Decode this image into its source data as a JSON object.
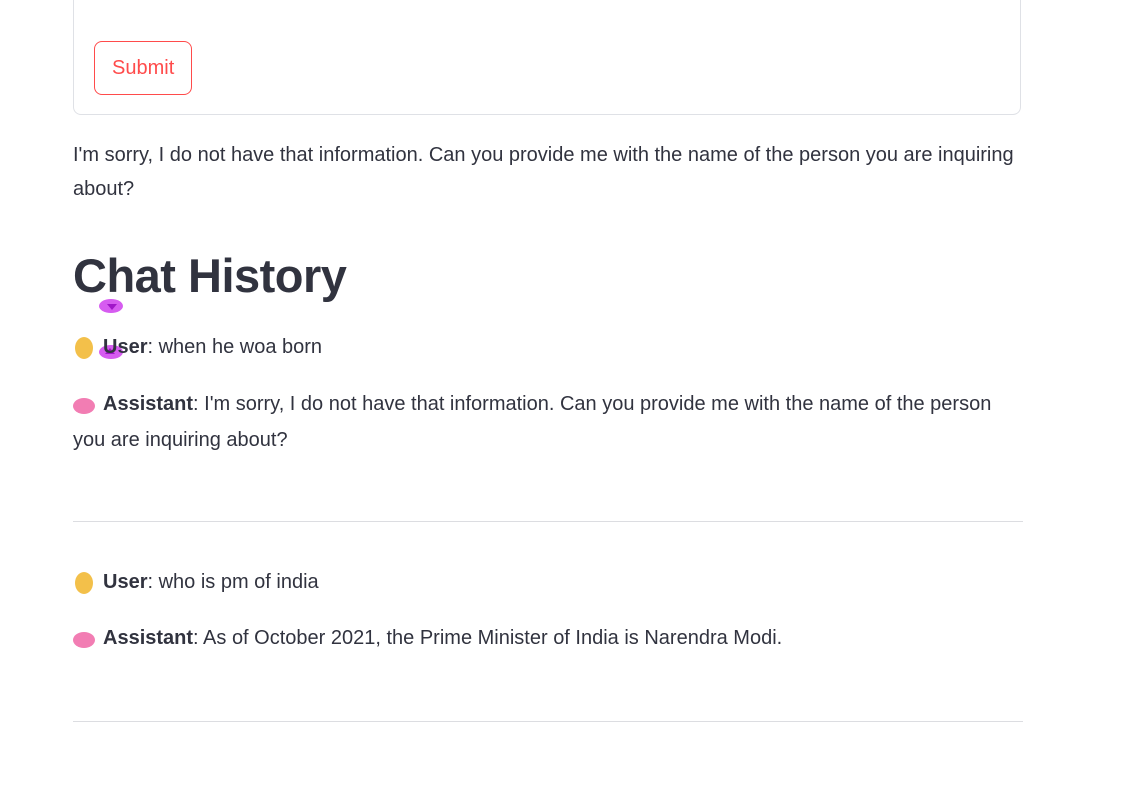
{
  "form": {
    "submit_label": "Submit"
  },
  "response": {
    "text": "I'm sorry, I do not have that information. Can you provide me with the name of the person you are inquiring about?"
  },
  "chat_history": {
    "title": "Chat History",
    "exchanges": [
      {
        "user_label": "User",
        "user_text": ": when he woa born",
        "assistant_label": "Assistant",
        "assistant_text": ": I'm sorry, I do not have that information. Can you provide me with the name of the person you are inquiring about?"
      },
      {
        "user_label": "User",
        "user_text": ": who is pm of india",
        "assistant_label": "Assistant",
        "assistant_text": ": As of October 2021, the Prime Minister of India is Narendra Modi."
      }
    ]
  },
  "icons": {
    "user": "user-face-icon",
    "assistant": "brain-icon"
  },
  "colors": {
    "accent": "#ff4b4b",
    "text": "#31333f",
    "divider": "#dcdde1",
    "blob": "#d65cf0"
  }
}
